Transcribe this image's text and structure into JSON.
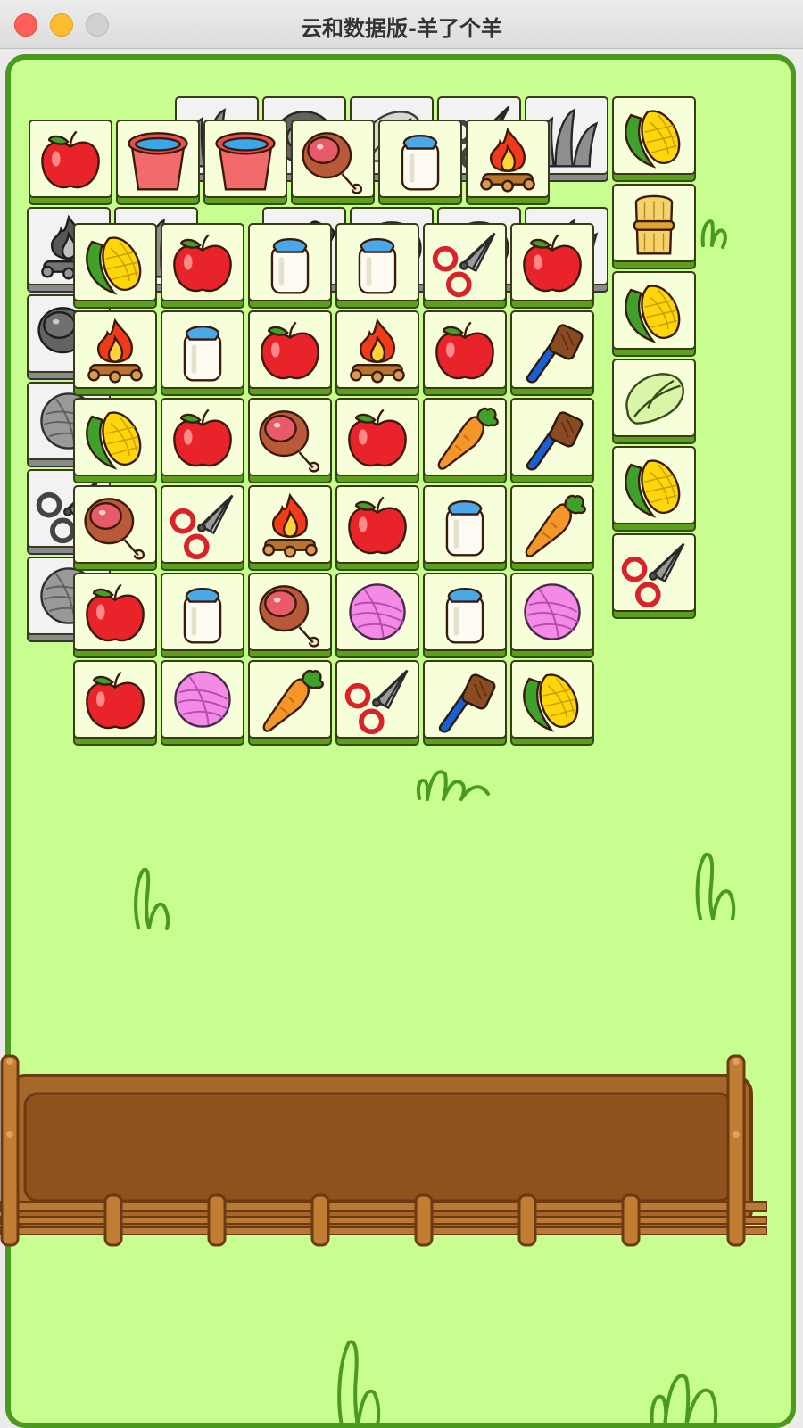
{
  "window": {
    "title": "云和数据版-羊了个羊"
  },
  "colors": {
    "field": "#c8fd90",
    "field_border": "#4a9a1e",
    "tile_face": "#f6ffda",
    "tile_base": "#5d9f1d",
    "tray_wood": "#a8672a",
    "tray_inner": "#8e531d"
  },
  "board": {
    "active_tiles": [
      {
        "icon": "apple-icon"
      },
      {
        "icon": "bucket-icon"
      },
      {
        "icon": "bucket-icon"
      },
      {
        "icon": "meat-icon"
      },
      {
        "icon": "milk-icon"
      },
      {
        "icon": "fire-icon"
      },
      {
        "icon": "corn-icon"
      },
      {
        "icon": "wheat-icon"
      },
      {
        "icon": "corn-icon"
      },
      {
        "icon": "cabbage-icon"
      },
      {
        "icon": "corn-icon"
      },
      {
        "icon": "shears-icon"
      },
      {
        "icon": "corn-icon"
      },
      {
        "icon": "apple-icon"
      },
      {
        "icon": "milk-icon"
      },
      {
        "icon": "milk-icon"
      },
      {
        "icon": "shears-icon"
      },
      {
        "icon": "apple-icon"
      },
      {
        "icon": "fire-icon"
      },
      {
        "icon": "milk-icon"
      },
      {
        "icon": "apple-icon"
      },
      {
        "icon": "fire-icon"
      },
      {
        "icon": "apple-icon"
      },
      {
        "icon": "brush-icon"
      },
      {
        "icon": "corn-icon"
      },
      {
        "icon": "apple-icon"
      },
      {
        "icon": "meat-icon"
      },
      {
        "icon": "apple-icon"
      },
      {
        "icon": "carrot-icon"
      },
      {
        "icon": "brush-icon"
      },
      {
        "icon": "meat-icon"
      },
      {
        "icon": "shears-icon"
      },
      {
        "icon": "fire-icon"
      },
      {
        "icon": "apple-icon"
      },
      {
        "icon": "milk-icon"
      },
      {
        "icon": "carrot-icon"
      },
      {
        "icon": "apple-icon"
      },
      {
        "icon": "milk-icon"
      },
      {
        "icon": "meat-icon"
      },
      {
        "icon": "yarn-icon"
      },
      {
        "icon": "milk-icon"
      },
      {
        "icon": "yarn-icon"
      },
      {
        "icon": "apple-icon"
      },
      {
        "icon": "yarn-icon"
      },
      {
        "icon": "carrot-icon"
      },
      {
        "icon": "shears-icon"
      },
      {
        "icon": "brush-icon"
      },
      {
        "icon": "corn-icon"
      }
    ],
    "blocked_tiles": [
      {
        "icon": "grass-icon"
      },
      {
        "icon": "bell-icon"
      },
      {
        "icon": "cabbage-icon"
      },
      {
        "icon": "shears-icon"
      },
      {
        "icon": "grass-icon"
      },
      {
        "icon": "fire-icon"
      },
      {
        "icon": "grass-icon"
      },
      {
        "icon": "brush-icon"
      },
      {
        "icon": "bell-icon"
      },
      {
        "icon": "bell-icon"
      },
      {
        "icon": "grass-icon"
      },
      {
        "icon": "meat-icon"
      },
      {
        "icon": "yarn-icon"
      },
      {
        "icon": "shears-icon"
      },
      {
        "icon": "yarn-icon"
      }
    ]
  },
  "tray": {
    "slots_filled": 0
  }
}
